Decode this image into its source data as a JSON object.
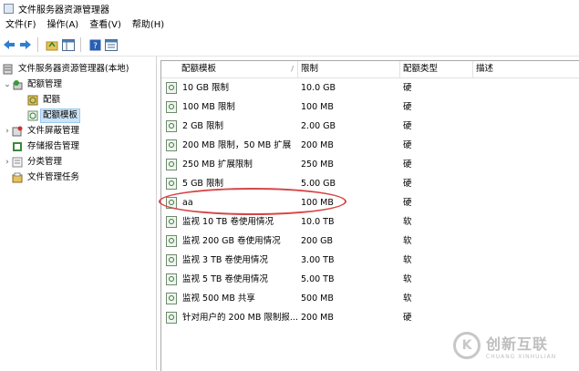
{
  "window": {
    "title": "文件服务器资源管理器"
  },
  "menu": [
    "文件(F)",
    "操作(A)",
    "查看(V)",
    "帮助(H)"
  ],
  "toolbar": {
    "icons": [
      "back-arrow-icon",
      "forward-arrow-icon",
      "up-folder-icon",
      "show-tree-icon",
      "help-icon",
      "properties-icon"
    ]
  },
  "tree": {
    "root": "文件服务器资源管理器(本地)",
    "quota_mgmt": "配额管理",
    "quotas": "配额",
    "quota_templates": "配额模板",
    "file_screening": "文件屏蔽管理",
    "storage_reports": "存储报告管理",
    "classification": "分类管理",
    "file_tasks": "文件管理任务"
  },
  "columns": [
    "配额模板",
    "限制",
    "配额类型",
    "描述"
  ],
  "rows": [
    {
      "name": "10 GB 限制",
      "limit": "10.0 GB",
      "type": "硬",
      "desc": ""
    },
    {
      "name": "100 MB 限制",
      "limit": "100 MB",
      "type": "硬",
      "desc": ""
    },
    {
      "name": "2 GB 限制",
      "limit": "2.00 GB",
      "type": "硬",
      "desc": ""
    },
    {
      "name": "200 MB 限制，50 MB 扩展",
      "limit": "200 MB",
      "type": "硬",
      "desc": ""
    },
    {
      "name": "250 MB 扩展限制",
      "limit": "250 MB",
      "type": "硬",
      "desc": ""
    },
    {
      "name": "5 GB 限制",
      "limit": "5.00 GB",
      "type": "硬",
      "desc": ""
    },
    {
      "name": "aa",
      "limit": "100 MB",
      "type": "硬",
      "desc": ""
    },
    {
      "name": "监视 10 TB 卷使用情况",
      "limit": "10.0 TB",
      "type": "软",
      "desc": ""
    },
    {
      "name": "监视 200 GB 卷使用情况",
      "limit": "200 GB",
      "type": "软",
      "desc": ""
    },
    {
      "name": "监视 3 TB 卷使用情况",
      "limit": "3.00 TB",
      "type": "软",
      "desc": ""
    },
    {
      "name": "监视 5 TB 卷使用情况",
      "limit": "5.00 TB",
      "type": "软",
      "desc": ""
    },
    {
      "name": "监视 500 MB 共享",
      "limit": "500 MB",
      "type": "软",
      "desc": ""
    },
    {
      "name": "针对用户的 200 MB 限制报...",
      "limit": "200 MB",
      "type": "硬",
      "desc": ""
    }
  ],
  "watermark": {
    "logo": "K",
    "cn": "创新互联",
    "en": "CHUANG XINHULIAN"
  }
}
